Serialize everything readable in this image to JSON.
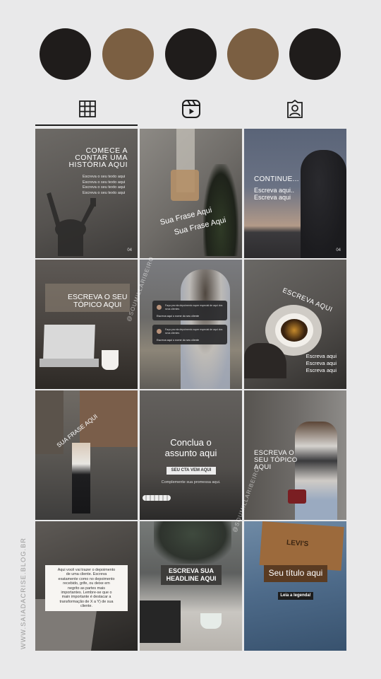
{
  "colors": {
    "dark": "#1f1c1b",
    "brown": "#7b5f42",
    "background": "#e9e9ea"
  },
  "highlights": [
    "dark",
    "brown",
    "dark",
    "brown",
    "dark"
  ],
  "tabs": [
    {
      "name": "grid",
      "icon": "grid-icon",
      "active": true
    },
    {
      "name": "reels",
      "icon": "reels-icon",
      "active": false
    },
    {
      "name": "tagged",
      "icon": "tagged-person-icon",
      "active": false
    }
  ],
  "side_url": "WWW.SAIADACRISE.BLOG.BR",
  "watermark": "@SOUMILLARIBEIRO",
  "posts": {
    "p1": {
      "title": "COMECE A\nCONTAR UMA\nHISTÓRIA AQUI",
      "lines": "Escreva o seu texto aqui\nEscreva o seu texto aqui\nEscreva o seu texto aqui\nEscreva o seu texto aqui",
      "num": "04"
    },
    "p2": {
      "line1": "Sua Frase Aqui",
      "line2": "Sua Frase Aqui"
    },
    "p3": {
      "title": "CONTINUE...",
      "lines": "Escreva aqui..\nEscreva aqui",
      "num": "04"
    },
    "p4": {
      "title": "ESCREVA O SEU\nTÓPICO AQUI"
    },
    "p5": {
      "card1_q": "Faça pra ela depoimento super especial de aqui dos seus clientes",
      "card1_a": "Escreva aqui o nome do seu cliente",
      "card2_q": "Faça pra ela depoimento super especial de aqui dos seus clientes",
      "card2_a": "Escreva aqui o nome do seu cliente"
    },
    "p6": {
      "title": "ESCREVA AQUI",
      "lines": "Escreva aqui\nEscreva aqui\nEscreva aqui"
    },
    "p7": {
      "title": "SUA FRASE AQUI"
    },
    "p8": {
      "title": "Conclua o\nassunto aqui",
      "cta": "SEU CTA VEM AQUI",
      "sub": "Complemente sua promessa aqui."
    },
    "p9": {
      "title": "ESCREVA O\nSEU TÓPICO\nAQUI"
    },
    "p10": {
      "text": "Aqui você vai trazer o depoimento\nde uma cliente. Escreva\nexatamente como no depoimento\nrecebido, grife, ou deixe em\nnegrito as partes mais\nimportantes. Lembre-se que o\nmain importante é destacar a\ntransformação de X a Y) de sua\ncliente."
    },
    "p11": {
      "title": "ESCREVA SUA\nHEADLINE AQUI"
    },
    "p12": {
      "label": "LEVI'S",
      "title": "Seu título aqui",
      "cta": "Leia a legenda!"
    }
  }
}
